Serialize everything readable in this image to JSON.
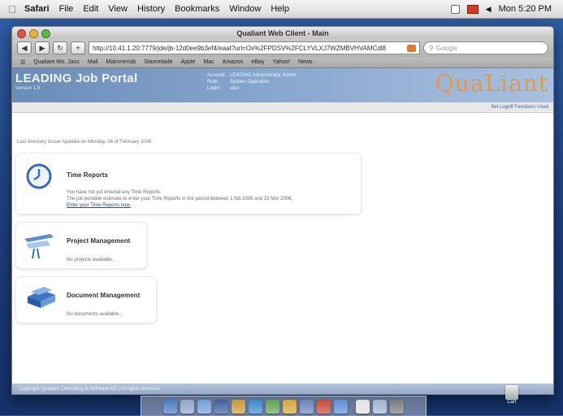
{
  "menubar": {
    "app": "Safari",
    "items": [
      "File",
      "Edit",
      "View",
      "History",
      "Bookmarks",
      "Window",
      "Help"
    ],
    "clock": "Mon 5:20 PM"
  },
  "window": {
    "title": "Qualiant Web Client - Main",
    "url": "http://10.41.1.20:7779/jde/jb-12d0ee9b3ef4/eaat?url=Ox%2FPDSV%2FCLYVLXJ7WZMBVHVAMCdl8",
    "search_placeholder": "Google",
    "bookmarks": [
      "Qualiant Ws. Jass",
      "Mail",
      "Mainmenüb",
      "Stammlade",
      "Apple",
      "Mac",
      "Amazon",
      "eBay",
      "Yahoo!",
      "News"
    ]
  },
  "header": {
    "title": "LEADING Job Portal",
    "version": "Version 1.0",
    "user_rows": [
      {
        "label": "Account:",
        "value": "LEADING Administrator Admin"
      },
      {
        "label": "Role:",
        "value": "System Operation"
      },
      {
        "label": "Login:",
        "value": "user"
      }
    ],
    "brand": "QuaLiant",
    "links": "Set Logoff Functions Used"
  },
  "welcome": "Last directory Ouser Apoolke on Monday, 06 of February 2006",
  "cards": {
    "time": {
      "title": "Time Reports",
      "line1": "You have not yet entered any Time Reports.",
      "line2": "The job portable estimate to enter your Time Reports in the period between 1 feb 2006 and 15 febr 2006.",
      "link": "Enter your Time Reports now."
    },
    "project": {
      "title": "Project Management",
      "text": "No projects available."
    },
    "document": {
      "title": "Document Management",
      "text": "No documents available."
    }
  },
  "statusbar": "Copyright Qualiant Consulting & Software AG | All rights reserved",
  "dock": {
    "icons": [
      "#4b79c4",
      "#8fa4c8",
      "#6f9edc",
      "#3e5f9a",
      "#c79a3a",
      "#3c87c9",
      "#5fa352",
      "#d4a63b",
      "#6a86b8",
      "#c34a3a",
      "#5d8ed6",
      "#e2e2e2",
      "#9fb4d0",
      "#7b7b7b"
    ],
    "trash_label": "Cart"
  }
}
